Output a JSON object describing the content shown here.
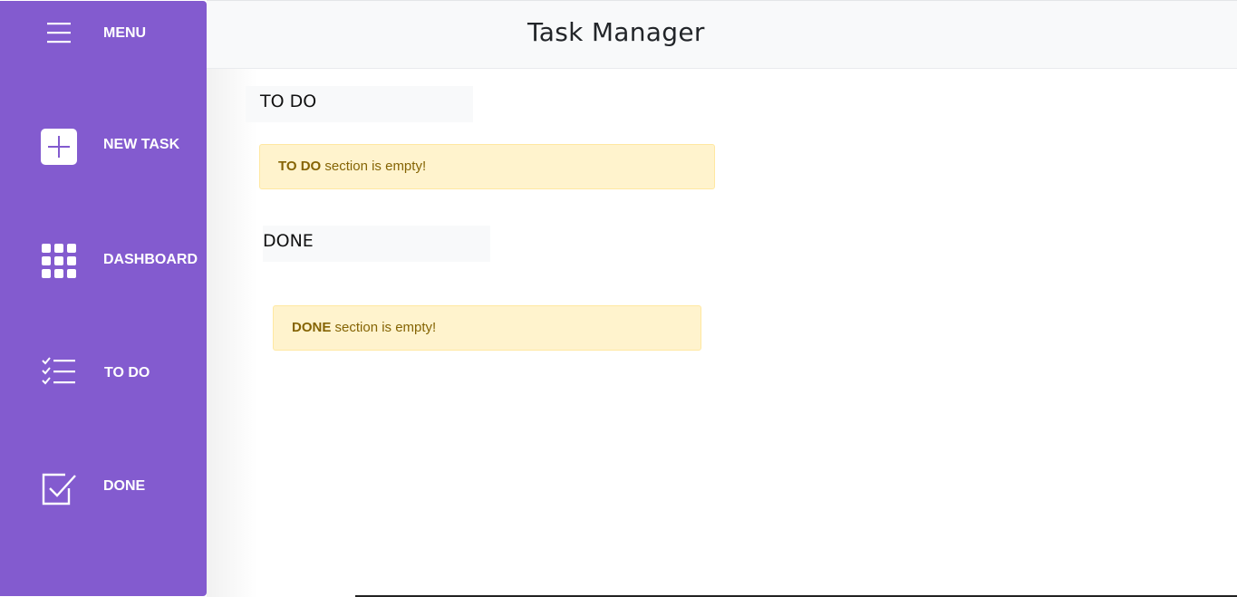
{
  "header": {
    "title": "Task Manager"
  },
  "sidebar": {
    "background": "#835bcf",
    "items": [
      {
        "label": "MENU",
        "icon": "hamburger-menu-icon"
      },
      {
        "label": "NEW TASK",
        "icon": "plus-square-icon"
      },
      {
        "label": "DASHBOARD",
        "icon": "grid-icon"
      },
      {
        "label": "TO DO",
        "icon": "checklist-icon"
      },
      {
        "label": "DONE",
        "icon": "checkbox-checked-icon"
      }
    ]
  },
  "sections": [
    {
      "title": "TO DO",
      "alert_bold": "TO DO",
      "alert_text": " section is empty!"
    },
    {
      "title": "DONE",
      "alert_bold": "DONE",
      "alert_text": " section is empty!"
    }
  ],
  "colors": {
    "alert_bg": "#fff3cd",
    "alert_text": "#856404",
    "header_bg": "#f8f9fa"
  }
}
